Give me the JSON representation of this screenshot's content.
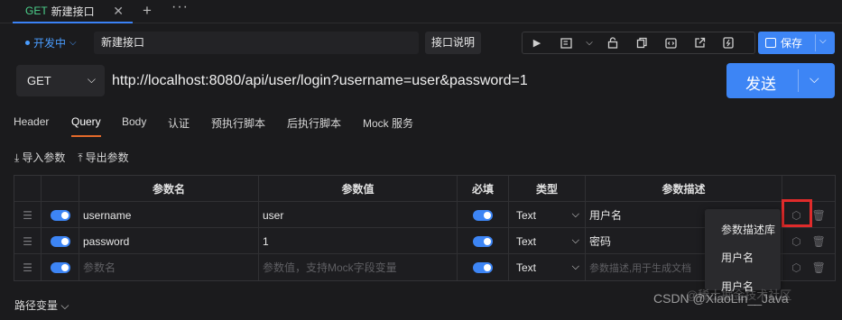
{
  "tab": {
    "method": "GET",
    "name": "新建接口",
    "close": "✕",
    "add": "+",
    "more": "···"
  },
  "toolbar": {
    "env": "开发中",
    "api_name": "新建接口",
    "doc_button": "接口说明",
    "save_label": "保存"
  },
  "request": {
    "method": "GET",
    "url": "http://localhost:8080/api/user/login?username=user&password=1",
    "send_label": "发送"
  },
  "req_tabs": [
    "Header",
    "Query",
    "Body",
    "认证",
    "预执行脚本",
    "后执行脚本",
    "Mock 服务"
  ],
  "active_tab": "Query",
  "actions": {
    "import": "导入参数",
    "export": "导出参数"
  },
  "table": {
    "headers": [
      "参数名",
      "参数值",
      "必填",
      "类型",
      "参数描述"
    ],
    "rows": [
      {
        "name": "username",
        "value": "user",
        "type": "Text",
        "desc": "用户名"
      },
      {
        "name": "password",
        "value": "1",
        "type": "Text",
        "desc": "密码"
      }
    ],
    "placeholder": {
      "name": "参数名",
      "value": "参数值，支持Mock字段变量",
      "type": "Text",
      "desc": "参数描述,用于生成文档"
    }
  },
  "popup": {
    "items": [
      "参数描述库",
      "用户名",
      "用户名"
    ]
  },
  "footer": {
    "path_vars": "路径变量"
  },
  "watermark": {
    "text": "CSDN @XiaoLin__Java",
    "text2": "@稀土掘金技术社区"
  },
  "colors": {
    "accent": "#3d85f5",
    "active_tab_underline": "#e46a2a",
    "get_method": "#4bd08b",
    "highlight": "#e02b2b"
  }
}
